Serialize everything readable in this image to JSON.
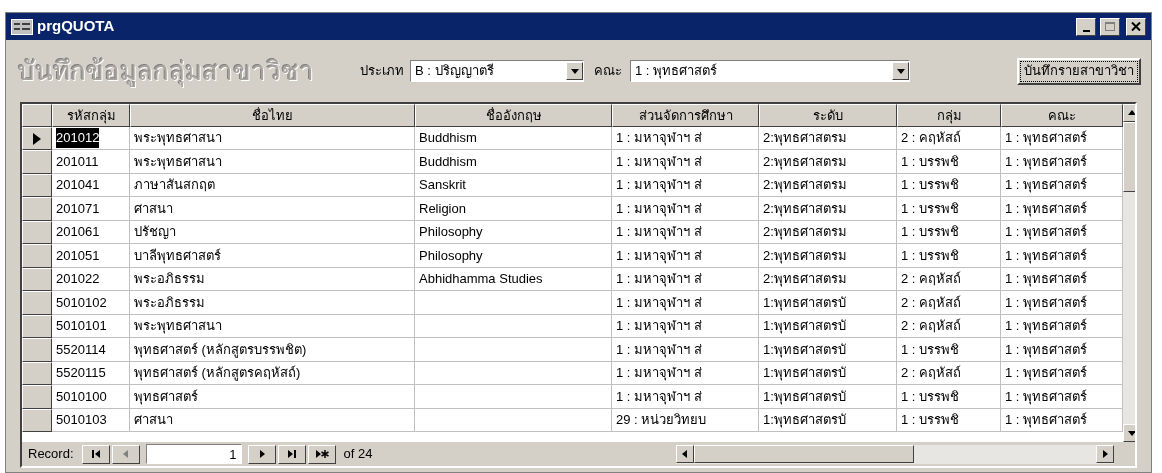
{
  "window": {
    "title": "prgQUOTA"
  },
  "header": {
    "title": "บันทึกข้อมูลกลุ่มสาขาวิชา",
    "type_label": "ประเภท",
    "type_value": "B : ปริญญาตรี",
    "faculty_label": "คณะ",
    "faculty_value": "1 : พุทธศาสตร์",
    "save_button": "บันทึกรายสาขาวิชา"
  },
  "table": {
    "columns": [
      "รหัสกลุ่ม",
      "ชื่อไทย",
      "ชื่ออังกฤษ",
      "ส่วนจัดการศึกษา",
      "ระดับ",
      "กลุ่ม",
      "คณะ"
    ],
    "rows": [
      {
        "selected": true,
        "cells": [
          "201012",
          "พระพุทธศาสนา",
          "Buddhism",
          "1 : มหาจุฬาฯ  ส่",
          "2:พุทธศาสตรม",
          "2 : คฤหัสถ์",
          "1 : พุทธศาสตร์"
        ]
      },
      {
        "selected": false,
        "cells": [
          "201011",
          "พระพุทธศาสนา",
          "Buddhism",
          "1 : มหาจุฬาฯ  ส่",
          "2:พุทธศาสตรม",
          "1 : บรรพชิ",
          "1 : พุทธศาสตร์"
        ]
      },
      {
        "selected": false,
        "cells": [
          "201041",
          "ภาษาสันสกฤต",
          "Sanskrit",
          "1 : มหาจุฬาฯ  ส่",
          "2:พุทธศาสตรม",
          "1 : บรรพชิ",
          "1 : พุทธศาสตร์"
        ]
      },
      {
        "selected": false,
        "cells": [
          "201071",
          "ศาสนา",
          "Religion",
          "1 : มหาจุฬาฯ  ส่",
          "2:พุทธศาสตรม",
          "1 : บรรพชิ",
          "1 : พุทธศาสตร์"
        ]
      },
      {
        "selected": false,
        "cells": [
          "201061",
          "ปรัชญา",
          "Philosophy",
          "1 : มหาจุฬาฯ  ส่",
          "2:พุทธศาสตรม",
          "1 : บรรพชิ",
          "1 : พุทธศาสตร์"
        ]
      },
      {
        "selected": false,
        "cells": [
          "201051",
          "บาลีพุทธศาสตร์",
          "Philosophy",
          "1 : มหาจุฬาฯ  ส่",
          "2:พุทธศาสตรม",
          "1 : บรรพชิ",
          "1 : พุทธศาสตร์"
        ]
      },
      {
        "selected": false,
        "cells": [
          "201022",
          "พระอภิธรรม",
          "Abhidhamma Studies",
          "1 : มหาจุฬาฯ  ส่",
          "2:พุทธศาสตรม",
          "2 : คฤหัสถ์",
          "1 : พุทธศาสตร์"
        ]
      },
      {
        "selected": false,
        "cells": [
          "5010102",
          "พระอภิธรรม",
          "",
          "1 : มหาจุฬาฯ  ส่",
          "1:พุทธศาสตรบั",
          "2 : คฤหัสถ์",
          "1 : พุทธศาสตร์"
        ]
      },
      {
        "selected": false,
        "cells": [
          "5010101",
          "พระพุทธศาสนา",
          "",
          "1 : มหาจุฬาฯ  ส่",
          "1:พุทธศาสตรบั",
          "2 : คฤหัสถ์",
          "1 : พุทธศาสตร์"
        ]
      },
      {
        "selected": false,
        "cells": [
          "5520114",
          "พุทธศาสตร์ (หลักสูตรบรรพชิต)",
          "",
          "1 : มหาจุฬาฯ  ส่",
          "1:พุทธศาสตรบั",
          "1 : บรรพชิ",
          "1 : พุทธศาสตร์"
        ]
      },
      {
        "selected": false,
        "cells": [
          "5520115",
          "พุทธศาสตร์ (หลักสูตรคฤหัสถ์)",
          "",
          "1 : มหาจุฬาฯ  ส่",
          "1:พุทธศาสตรบั",
          "2 : คฤหัสถ์",
          "1 : พุทธศาสตร์"
        ]
      },
      {
        "selected": false,
        "cells": [
          "5010100",
          "พุทธศาสตร์",
          "",
          "1 : มหาจุฬาฯ  ส่",
          "1:พุทธศาสตรบั",
          "1 : บรรพชิ",
          "1 : พุทธศาสตร์"
        ]
      },
      {
        "selected": false,
        "cells": [
          "5010103",
          "ศาสนา",
          "",
          "29 : หน่วยวิทยบ",
          "1:พุทธศาสตรบั",
          "1 : บรรพชิ",
          "1 : พุทธศาสตร์"
        ]
      }
    ]
  },
  "navigation": {
    "label": "Record:",
    "current": "1",
    "total": "of 24"
  }
}
